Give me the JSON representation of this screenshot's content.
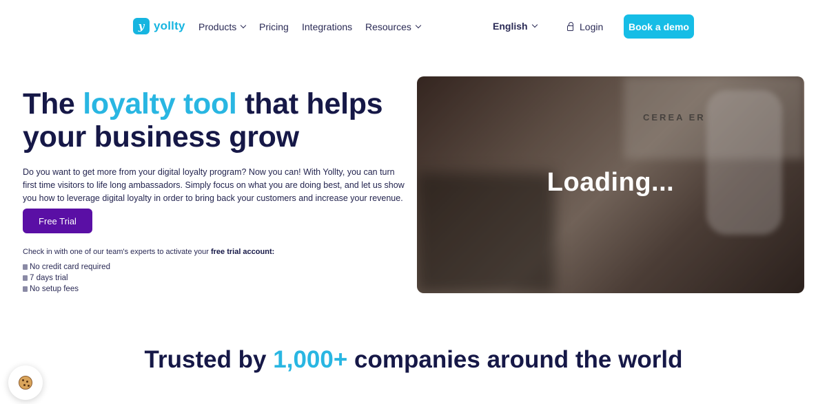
{
  "nav": {
    "logo_text": "yollty",
    "logo_mark": "y",
    "items": [
      {
        "label": "Products",
        "has_dropdown": true
      },
      {
        "label": "Pricing",
        "has_dropdown": false
      },
      {
        "label": "Integrations",
        "has_dropdown": false
      },
      {
        "label": "Resources",
        "has_dropdown": true
      }
    ],
    "language": "English",
    "login": "Login",
    "cta": "Book a demo"
  },
  "hero": {
    "title_part1": "The ",
    "title_highlight": "loyalty tool",
    "title_part2": " that helps your business grow",
    "description": "Do you want to get more from your digital loyalty program? Now you can! With Yollty, you can turn first time visitors to life long ambassadors. Simply focus on what you are doing best, and let us show you how to leverage digital loyalty in order to bring back your customers and increase your revenue.",
    "cta": "Free Trial",
    "checkin_text": "Check in with one of our team's experts to activate your ",
    "checkin_bold": "free trial account:",
    "features": [
      "No credit card required",
      "7 days trial",
      "No setup fees"
    ]
  },
  "video": {
    "status": "Loading...",
    "sign_text": "CEREA          ER"
  },
  "trusted": {
    "part1": "Trusted by ",
    "highlight": "1,000+",
    "part2": " companies around the world"
  },
  "icons": {
    "logo": "yollty-logo-icon",
    "chevron": "chevron-down-icon",
    "lock": "lock-icon",
    "bullet": "bullet-icon",
    "cookie": "cookie-icon"
  },
  "colors": {
    "accent": "#16bde6",
    "primary_dark": "#161847",
    "trial_button": "#5a0fa5"
  }
}
